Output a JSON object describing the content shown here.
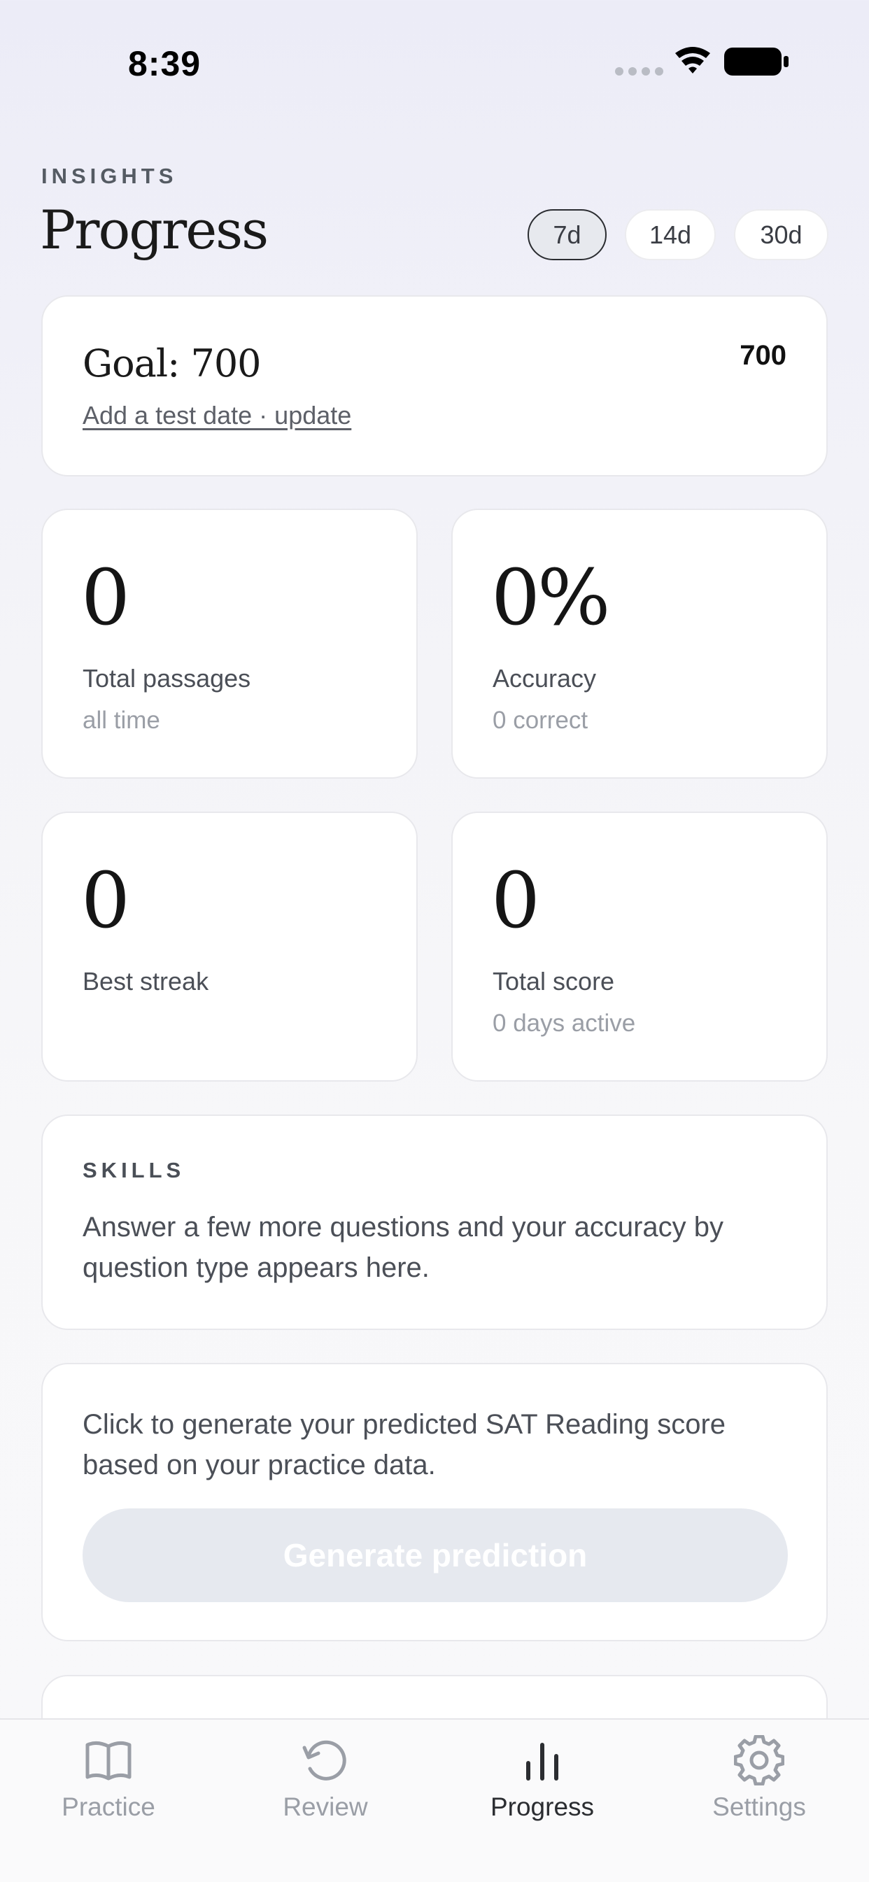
{
  "status_bar": {
    "time": "8:39"
  },
  "header": {
    "eyebrow": "INSIGHTS",
    "title": "Progress"
  },
  "range_tabs": [
    {
      "label": "7d",
      "active": true
    },
    {
      "label": "14d",
      "active": false
    },
    {
      "label": "30d",
      "active": false
    }
  ],
  "goal": {
    "title": "Goal: 700",
    "link": "Add a test date · update",
    "value": "700"
  },
  "stats": [
    {
      "value": "0",
      "label": "Total passages",
      "sub": "all time"
    },
    {
      "value": "0%",
      "label": "Accuracy",
      "sub": "0 correct"
    },
    {
      "value": "0",
      "label": "Best streak",
      "sub": ""
    },
    {
      "value": "0",
      "label": "Total score",
      "sub": "0 days active"
    }
  ],
  "skills": {
    "eyebrow": "SKILLS",
    "text": "Answer a few more questions and your accuracy by question type appears here."
  },
  "prediction": {
    "text": "Click to generate your predicted SAT Reading score based on your practice data.",
    "button_label": "Generate prediction"
  },
  "tabbar": [
    {
      "label": "Practice",
      "icon": "book-icon",
      "active": false
    },
    {
      "label": "Review",
      "icon": "history-icon",
      "active": false
    },
    {
      "label": "Progress",
      "icon": "bar-chart-icon",
      "active": true
    },
    {
      "label": "Settings",
      "icon": "gear-icon",
      "active": false
    }
  ],
  "colors": {
    "accent_text": "#2b2d31",
    "muted": "#9a9ea6",
    "button_disabled": "#e6e9ef"
  }
}
